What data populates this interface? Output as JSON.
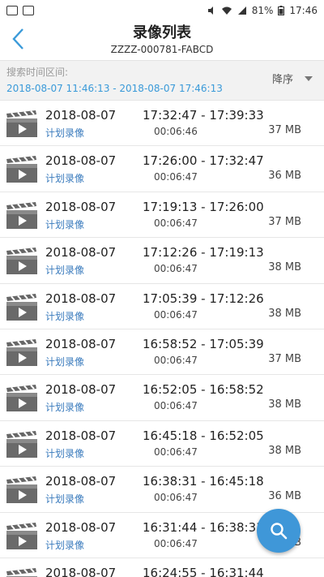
{
  "status_bar": {
    "battery": "81%",
    "time": "17:46"
  },
  "header": {
    "title": "录像列表",
    "device_id": "ZZZZ-000781-FABCD"
  },
  "filter": {
    "label": "搜索时间区间:",
    "range": "2018-08-07 11:46:13 - 2018-08-07 17:46:13",
    "sort": "降序"
  },
  "recordings": [
    {
      "date": "2018-08-07",
      "type": "计划录像",
      "time": "17:32:47 - 17:39:33",
      "duration": "00:06:46",
      "size": "37 MB"
    },
    {
      "date": "2018-08-07",
      "type": "计划录像",
      "time": "17:26:00 - 17:32:47",
      "duration": "00:06:47",
      "size": "36 MB"
    },
    {
      "date": "2018-08-07",
      "type": "计划录像",
      "time": "17:19:13 - 17:26:00",
      "duration": "00:06:47",
      "size": "37 MB"
    },
    {
      "date": "2018-08-07",
      "type": "计划录像",
      "time": "17:12:26 - 17:19:13",
      "duration": "00:06:47",
      "size": "38 MB"
    },
    {
      "date": "2018-08-07",
      "type": "计划录像",
      "time": "17:05:39 - 17:12:26",
      "duration": "00:06:47",
      "size": "38 MB"
    },
    {
      "date": "2018-08-07",
      "type": "计划录像",
      "time": "16:58:52 - 17:05:39",
      "duration": "00:06:47",
      "size": "37 MB"
    },
    {
      "date": "2018-08-07",
      "type": "计划录像",
      "time": "16:52:05 - 16:58:52",
      "duration": "00:06:47",
      "size": "38 MB"
    },
    {
      "date": "2018-08-07",
      "type": "计划录像",
      "time": "16:45:18 - 16:52:05",
      "duration": "00:06:47",
      "size": "38 MB"
    },
    {
      "date": "2018-08-07",
      "type": "计划录像",
      "time": "16:38:31 - 16:45:18",
      "duration": "00:06:47",
      "size": "36 MB"
    },
    {
      "date": "2018-08-07",
      "type": "计划录像",
      "time": "16:31:44 - 16:38:31",
      "duration": "00:06:47",
      "size": "37 MB"
    },
    {
      "date": "2018-08-07",
      "type": "",
      "time": "16:24:55 - 16:31:44",
      "duration": "",
      "size": ""
    }
  ]
}
